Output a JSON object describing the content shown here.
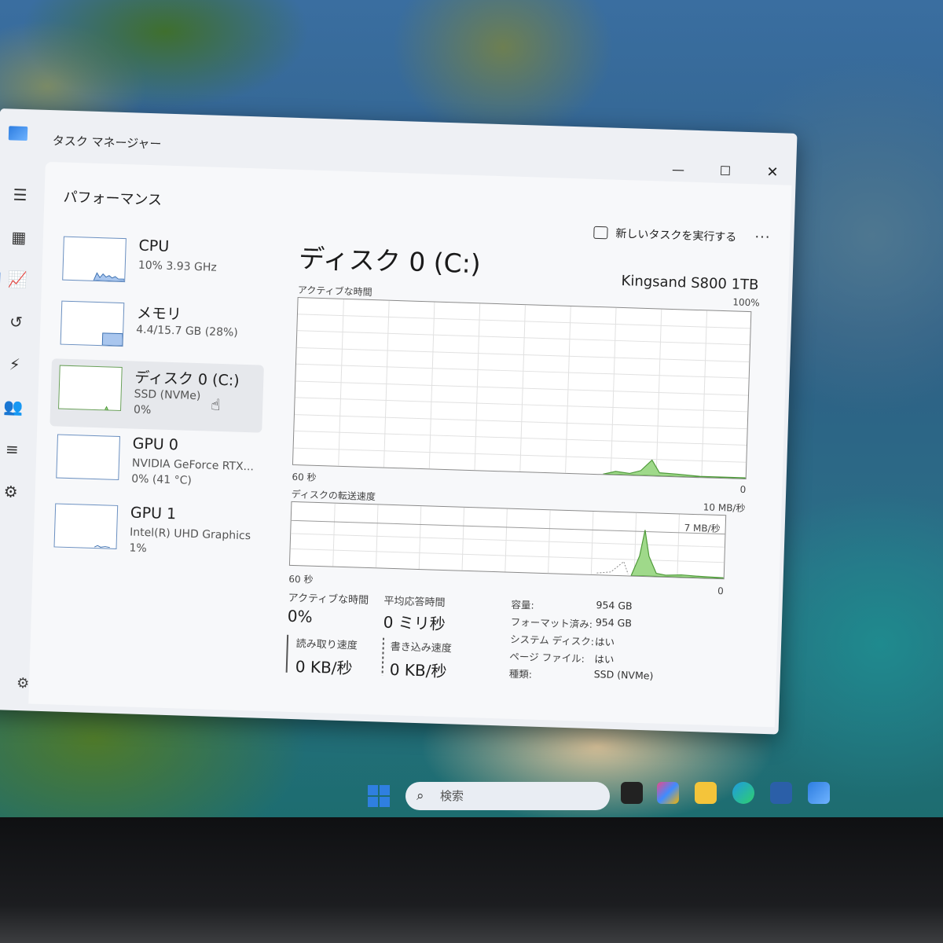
{
  "window": {
    "title": "タスク マネージャー",
    "minimize": "—",
    "maximize": "☐",
    "close": "✕"
  },
  "header": {
    "page_title": "パフォーマンス",
    "run_task_label": "新しいタスクを実行する",
    "more": "..."
  },
  "nav": {
    "icons": [
      "menu-icon",
      "processes-icon",
      "performance-icon",
      "app-history-icon",
      "startup-apps-icon",
      "users-icon",
      "details-icon",
      "services-icon",
      "settings-icon"
    ]
  },
  "devices": [
    {
      "name": "CPU",
      "sub": "10% 3.93 GHz",
      "sub2": ""
    },
    {
      "name": "メモリ",
      "sub": "4.4/15.7 GB (28%)",
      "sub2": ""
    },
    {
      "name": "ディスク 0 (C:)",
      "sub": "SSD (NVMe)",
      "sub2": "0%"
    },
    {
      "name": "GPU 0",
      "sub": "NVIDIA GeForce RTX...",
      "sub2": "0% (41 °C)"
    },
    {
      "name": "GPU 1",
      "sub": "Intel(R) UHD Graphics",
      "sub2": "1%"
    }
  ],
  "detail": {
    "title": "ディスク 0 (C:)",
    "model": "Kingsand S800 1TB",
    "active_time_graph": {
      "label": "アクティブな時間",
      "max_label": "100%",
      "time_label": "60 秒",
      "zero_label": "0"
    },
    "transfer_graph": {
      "label": "ディスクの転送速度",
      "max_label": "10 MB/秒",
      "mid_label": "7 MB/秒",
      "time_label": "60 秒",
      "zero_label": "0"
    },
    "stats": {
      "active_time_label": "アクティブな時間",
      "active_time_value": "0%",
      "avg_response_label": "平均応答時間",
      "avg_response_value": "0 ミリ秒",
      "read_speed_label": "読み取り速度",
      "read_speed_value": "0 KB/秒",
      "write_speed_label": "書き込み速度",
      "write_speed_value": "0 KB/秒"
    },
    "properties": [
      {
        "label": "容量:",
        "value": "954 GB"
      },
      {
        "label": "フォーマット済み:",
        "value": "954 GB"
      },
      {
        "label": "システム ディスク:",
        "value": "はい"
      },
      {
        "label": "ページ ファイル:",
        "value": "はい"
      },
      {
        "label": "種類:",
        "value": "SSD (NVMe)"
      }
    ]
  },
  "taskbar": {
    "search_placeholder": "検索"
  },
  "colors": {
    "accent": "#2a6fd6",
    "disk_fill": "#9fd98a",
    "disk_line": "#4f9a3a",
    "memory_fill": "#a9c6ee"
  }
}
